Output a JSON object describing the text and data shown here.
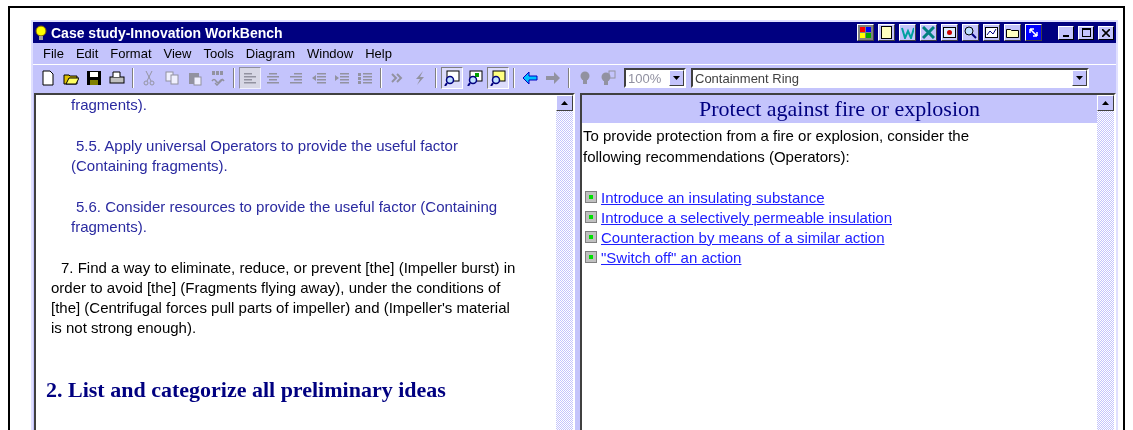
{
  "window": {
    "title": "Case study-Innovation WorkBench"
  },
  "menu": [
    "File",
    "Edit",
    "Format",
    "View",
    "Tools",
    "Diagram",
    "Window",
    "Help"
  ],
  "toolbar": [
    {
      "kind": "new",
      "disabled": false,
      "pressed": false
    },
    {
      "kind": "open",
      "disabled": false,
      "pressed": false
    },
    {
      "kind": "save",
      "disabled": false,
      "pressed": false
    },
    {
      "kind": "print",
      "disabled": false,
      "pressed": false
    },
    {
      "kind": "sep"
    },
    {
      "kind": "cut",
      "disabled": true,
      "pressed": false
    },
    {
      "kind": "copy",
      "disabled": true,
      "pressed": false
    },
    {
      "kind": "paste",
      "disabled": true,
      "pressed": false
    },
    {
      "kind": "spell",
      "disabled": true,
      "pressed": false
    },
    {
      "kind": "sep"
    },
    {
      "kind": "align-left",
      "disabled": true,
      "pressed": true
    },
    {
      "kind": "center",
      "disabled": true,
      "pressed": false
    },
    {
      "kind": "align-right",
      "disabled": true,
      "pressed": false
    },
    {
      "kind": "outdent",
      "disabled": true,
      "pressed": false
    },
    {
      "kind": "indent",
      "disabled": true,
      "pressed": false
    },
    {
      "kind": "bullets",
      "disabled": true,
      "pressed": false
    },
    {
      "kind": "sep"
    },
    {
      "kind": "forward",
      "disabled": true,
      "pressed": false
    },
    {
      "kind": "bolt",
      "disabled": true,
      "pressed": false
    },
    {
      "kind": "sep"
    },
    {
      "kind": "view-a",
      "disabled": false,
      "pressed": true
    },
    {
      "kind": "view-b",
      "disabled": false,
      "pressed": false
    },
    {
      "kind": "view-c",
      "disabled": false,
      "pressed": true
    },
    {
      "kind": "sep"
    },
    {
      "kind": "back",
      "disabled": false,
      "pressed": false
    },
    {
      "kind": "next",
      "disabled": true,
      "pressed": false
    },
    {
      "kind": "sep"
    },
    {
      "kind": "bulb",
      "disabled": true,
      "pressed": false
    },
    {
      "kind": "bulb-grid",
      "disabled": true,
      "pressed": false
    }
  ],
  "zoom_box": {
    "value": "100%",
    "disabled": true
  },
  "topic_box": {
    "value": "Containment Ring"
  },
  "left_pane": {
    "paragraphs": [
      {
        "kind": "continuation",
        "text": "fragments)."
      },
      {
        "kind": "operator",
        "text": "5.5. Apply universal Operators to provide the useful factor (Containing fragments)."
      },
      {
        "kind": "operator",
        "text": "5.6. Consider resources to provide the useful factor (Containing fragments)."
      },
      {
        "kind": "step",
        "text": "7. Find a way to eliminate, reduce, or prevent [the] (Impeller burst) in order to avoid [the] (Fragments flying away), under the conditions of [the] (Centrifugal forces pull parts of impeller) and (Impeller's material is not strong enough)."
      },
      {
        "kind": "heading",
        "text": "2. List and categorize all preliminary ideas"
      }
    ]
  },
  "right_pane": {
    "title": "Protect against fire or explosion",
    "intro": "To provide protection from a fire or explosion, consider the following recommendations (Operators):",
    "links": [
      "Introduce an insulating substance",
      "Introduce a selectively permeable insulation",
      "Counteraction by means of a similar action",
      "\"Switch off\" an action"
    ]
  }
}
